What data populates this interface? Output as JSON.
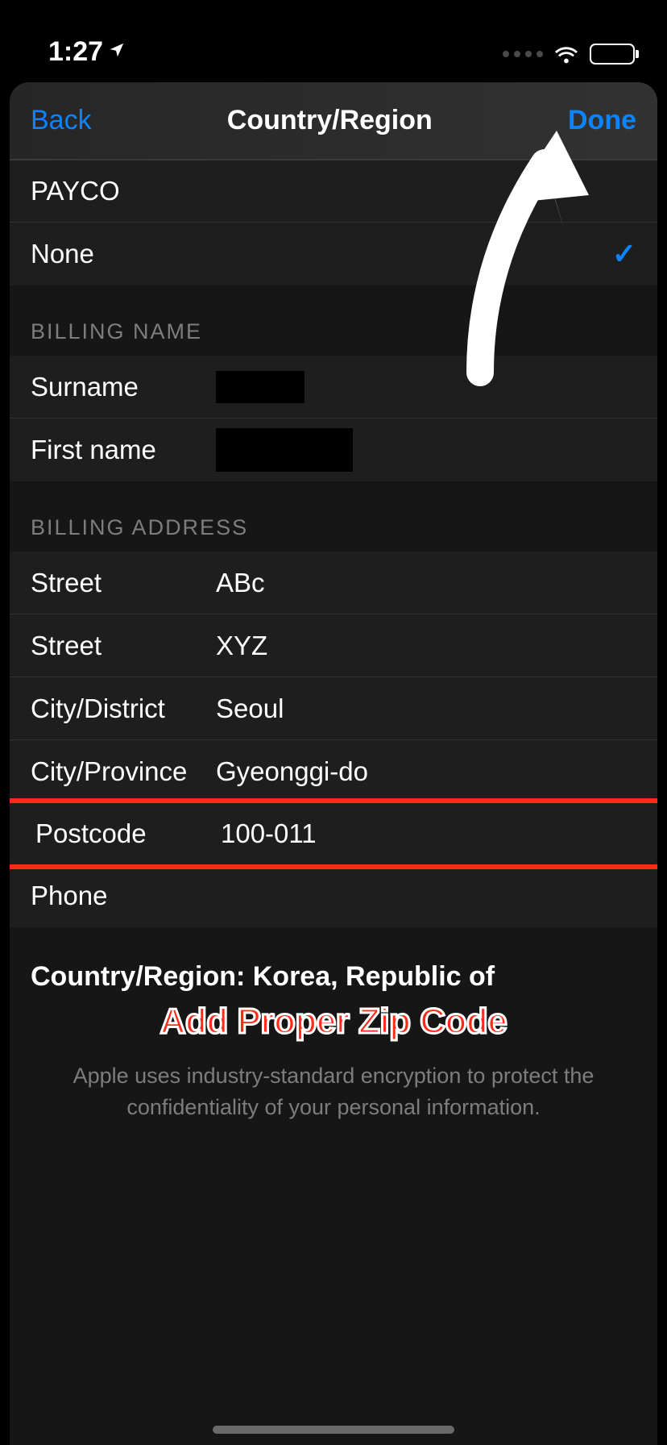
{
  "status": {
    "time": "1:27"
  },
  "nav": {
    "back": "Back",
    "title": "Country/Region",
    "done": "Done"
  },
  "payment": {
    "payco_label": "PAYCO",
    "none_label": "None"
  },
  "sections": {
    "billing_name": "BILLING NAME",
    "billing_address": "BILLING ADDRESS"
  },
  "name": {
    "surname_label": "Surname",
    "firstname_label": "First name"
  },
  "address": {
    "street1_label": "Street",
    "street1_value": "ABc",
    "street2_label": "Street",
    "street2_value": "XYZ",
    "city_label": "City/District",
    "city_value": "Seoul",
    "province_label": "City/Province",
    "province_value": "Gyeonggi-do",
    "postcode_label": "Postcode",
    "postcode_value": "100-011",
    "phone_label": "Phone"
  },
  "country_line": "Country/Region: Korea, Republic of",
  "footer": "Apple uses industry-standard encryption to protect the confidentiality of your personal information.",
  "annotation": "Add Proper Zip Code"
}
